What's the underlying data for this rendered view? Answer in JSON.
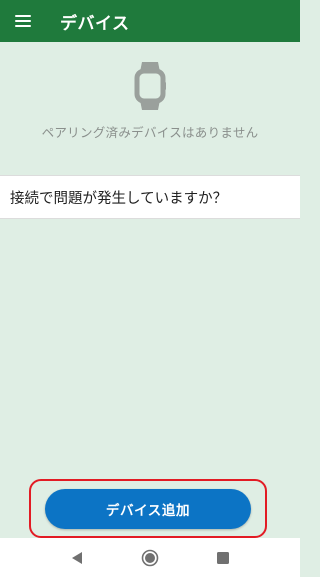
{
  "app_bar": {
    "title": "デバイス",
    "menu_icon": "hamburger-menu-icon",
    "background_color": "#1f7a3c"
  },
  "empty_state": {
    "icon": "smartwatch-icon",
    "message": "ペアリング済みデバイスはありません"
  },
  "help": {
    "label": "接続で問題が発生していますか？"
  },
  "add_device": {
    "label": "デバイス追加",
    "button_color": "#0c74c5",
    "highlight_color": "#e21b24"
  },
  "system_nav": {
    "back_icon": "back-triangle-icon",
    "home_icon": "home-circle-icon",
    "recents_icon": "recents-square-icon"
  }
}
